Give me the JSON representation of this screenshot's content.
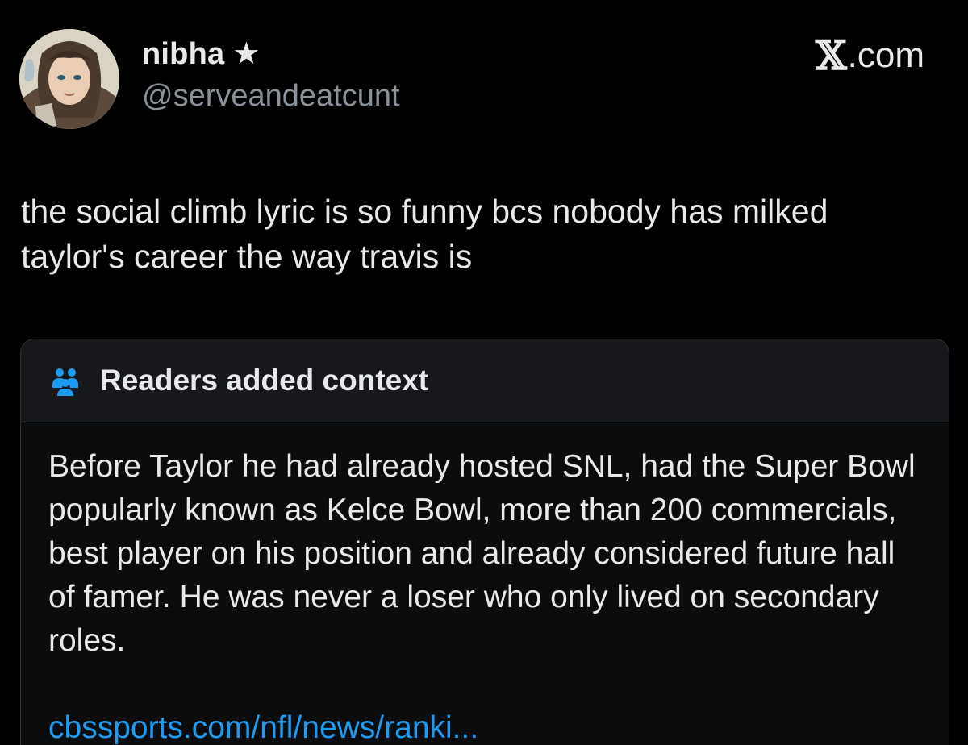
{
  "post": {
    "author": {
      "display_name": "nibha",
      "badge_icon": "star-icon",
      "badge_glyph": "★",
      "handle": "@serveandeatcunt"
    },
    "brand": {
      "x_glyph": "𝕏",
      "suffix": ".com"
    },
    "text": "the social climb lyric is so funny bcs nobody has milked taylor's career the way travis is"
  },
  "community_note": {
    "icon": "people-icon",
    "title": "Readers added context",
    "body": "Before Taylor he had already hosted SNL, had the Super Bowl popularly known as Kelce Bowl, more than 200 commercials, best player on his position and already considered future hall of famer. He was never a loser who only lived on secondary roles.",
    "link": "cbssports.com/nfl/news/ranki..."
  },
  "colors": {
    "background": "#000000",
    "text_primary": "#e7e9ea",
    "text_secondary": "#8b9199",
    "link": "#1d9bf0",
    "note_icon": "#1d9bf0",
    "card_border": "#2f3336"
  }
}
